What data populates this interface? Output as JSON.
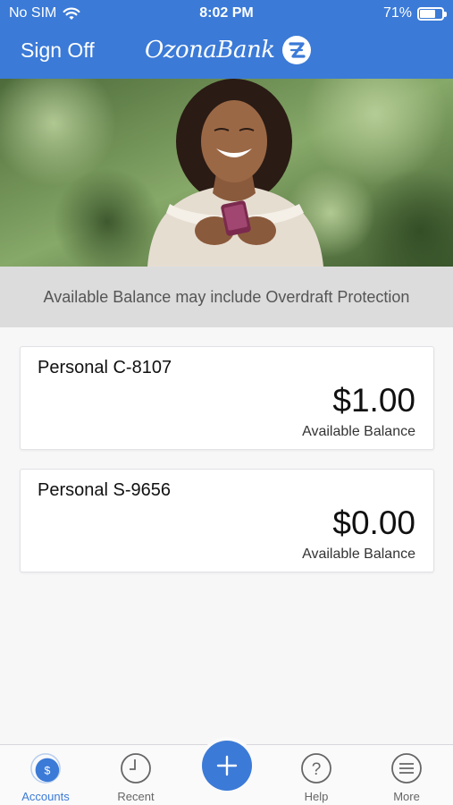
{
  "status_bar": {
    "carrier": "No SIM",
    "time": "8:02 PM",
    "battery": "71%",
    "battery_level": 0.71
  },
  "header": {
    "sign_off": "Sign Off",
    "logo_text": "OzonaBank",
    "logo_mark": "Z",
    "color": "#3b7ad7"
  },
  "notice": {
    "text": "Available Balance may include Overdraft Protection"
  },
  "accounts": [
    {
      "name": "Personal C-8107",
      "balance": "$1.00",
      "label": "Available Balance"
    },
    {
      "name": "Personal S-9656",
      "balance": "$0.00",
      "label": "Available Balance"
    }
  ],
  "tabs": [
    {
      "label": "Accounts",
      "icon": "dollar-circle-icon",
      "active": true
    },
    {
      "label": "Recent",
      "icon": "clock-icon",
      "active": false
    },
    {
      "label": "Help",
      "icon": "question-icon",
      "active": false
    },
    {
      "label": "More",
      "icon": "menu-icon",
      "active": false
    }
  ],
  "fab": {
    "icon": "plus-icon"
  }
}
